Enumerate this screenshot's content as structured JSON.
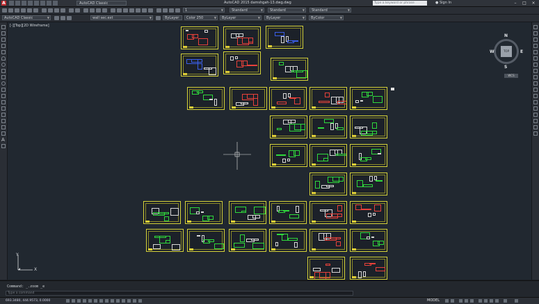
{
  "titlebar": {
    "app_logo": "A",
    "workspace": "AutoCAD Classic",
    "title": "AutoCAD 2015    damshgah-13.dwg.dwg",
    "search_placeholder": "Type a keyword or phrase",
    "signin": "Sign In"
  },
  "toolbar1": {
    "scale": "1",
    "text_style": "Standard",
    "dim_style": "Standard",
    "table_style": "Standard"
  },
  "toolbar2": {
    "workspace": "AutoCAD Classic",
    "layer": "wall sec.ext",
    "color": "ByLayer",
    "linetype": "ByLayer",
    "lineweight": "ByLayer",
    "plot_style": "ByColor",
    "color_box": "Color 250"
  },
  "viewport": {
    "label": "[-][Top][2D Wireframe]"
  },
  "viewcube": {
    "north": "N",
    "south": "S",
    "east": "E",
    "west": "W",
    "top_face": "TOP",
    "wcs": "WCS"
  },
  "ucs": {
    "x_label": "X",
    "y_label": "Y"
  },
  "command": {
    "history": "Command:  _.zoom _e",
    "prompt": "Type a command"
  },
  "status": {
    "coords": "693.3480, 444.9573, 0.0000",
    "model": "MODEL"
  },
  "colors": {
    "frame": "#d7d43a",
    "background": "#212830",
    "accent_green": "#2fd93c",
    "accent_red": "#e8413a",
    "accent_blue": "#3a5ee8"
  }
}
